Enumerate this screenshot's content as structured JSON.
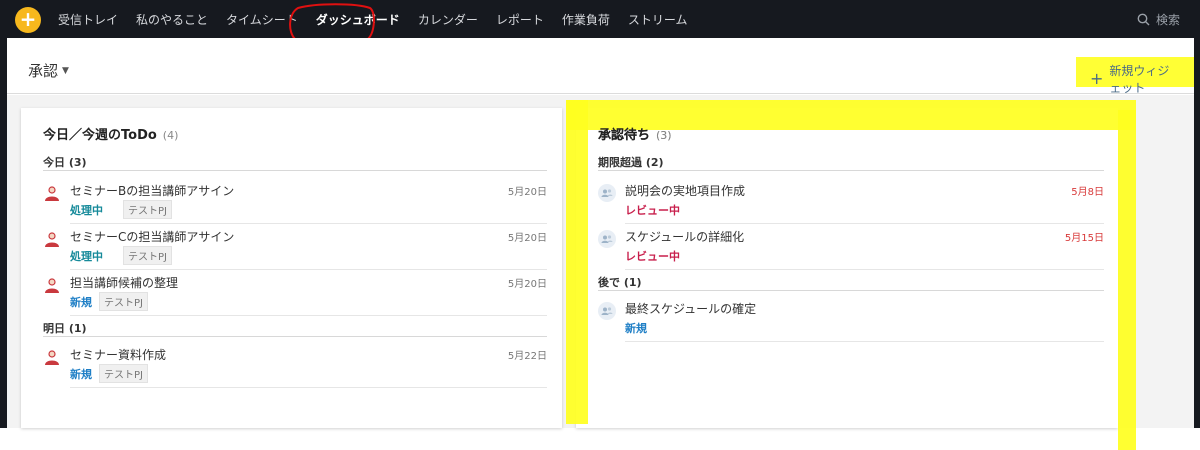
{
  "topnav": {
    "add_symbol": "+",
    "items": [
      {
        "label": "受信トレイ"
      },
      {
        "label": "私のやること"
      },
      {
        "label": "タイムシート"
      },
      {
        "label": "ダッシュボード"
      },
      {
        "label": "カレンダー"
      },
      {
        "label": "レポート"
      },
      {
        "label": "作業負荷"
      },
      {
        "label": "ストリーム"
      }
    ],
    "active_item": "ダッシュボード",
    "search_label": "検索"
  },
  "header": {
    "title": "承認",
    "new_widget_label": "新規ウィジェット"
  },
  "todo_card": {
    "title": "今日／今週のToDo",
    "count": "(4)",
    "sections": [
      {
        "label": "今日 (3)",
        "tasks": [
          {
            "name": "セミナーBの担当講師アサイン",
            "status": "処理中",
            "tag": "テストPJ",
            "date": "5月20日"
          },
          {
            "name": "セミナーCの担当講師アサイン",
            "status": "処理中",
            "tag": "テストPJ",
            "date": "5月20日"
          },
          {
            "name": "担当講師候補の整理",
            "status": "新規",
            "tag": "テストPJ",
            "date": "5月20日"
          }
        ]
      },
      {
        "label": "明日 (1)",
        "tasks": [
          {
            "name": "セミナー資料作成",
            "status": "新規",
            "tag": "テストPJ",
            "date": "5月22日"
          }
        ]
      }
    ]
  },
  "approval_card": {
    "title": "承認待ち",
    "count": "(3)",
    "sections": [
      {
        "label": "期限超過 (2)",
        "tasks": [
          {
            "name": "説明会の実地項目作成",
            "status": "レビュー中",
            "date": "5月8日"
          },
          {
            "name": "スケジュールの詳細化",
            "status": "レビュー中",
            "date": "5月15日"
          }
        ]
      },
      {
        "label": "後で (1)",
        "tasks": [
          {
            "name": "最終スケジュールの確定",
            "status": "新規",
            "date": ""
          }
        ]
      }
    ]
  },
  "colors": {
    "nav_bg": "#16191f",
    "add_button": "#f7b81d",
    "status_in_progress": "#168a9a",
    "status_new": "#1f7fc6",
    "status_review": "#c81f4c",
    "overdue_date": "#d83a3a",
    "annotation_yellow": "#ffff1f",
    "annotation_red": "#e01010"
  }
}
